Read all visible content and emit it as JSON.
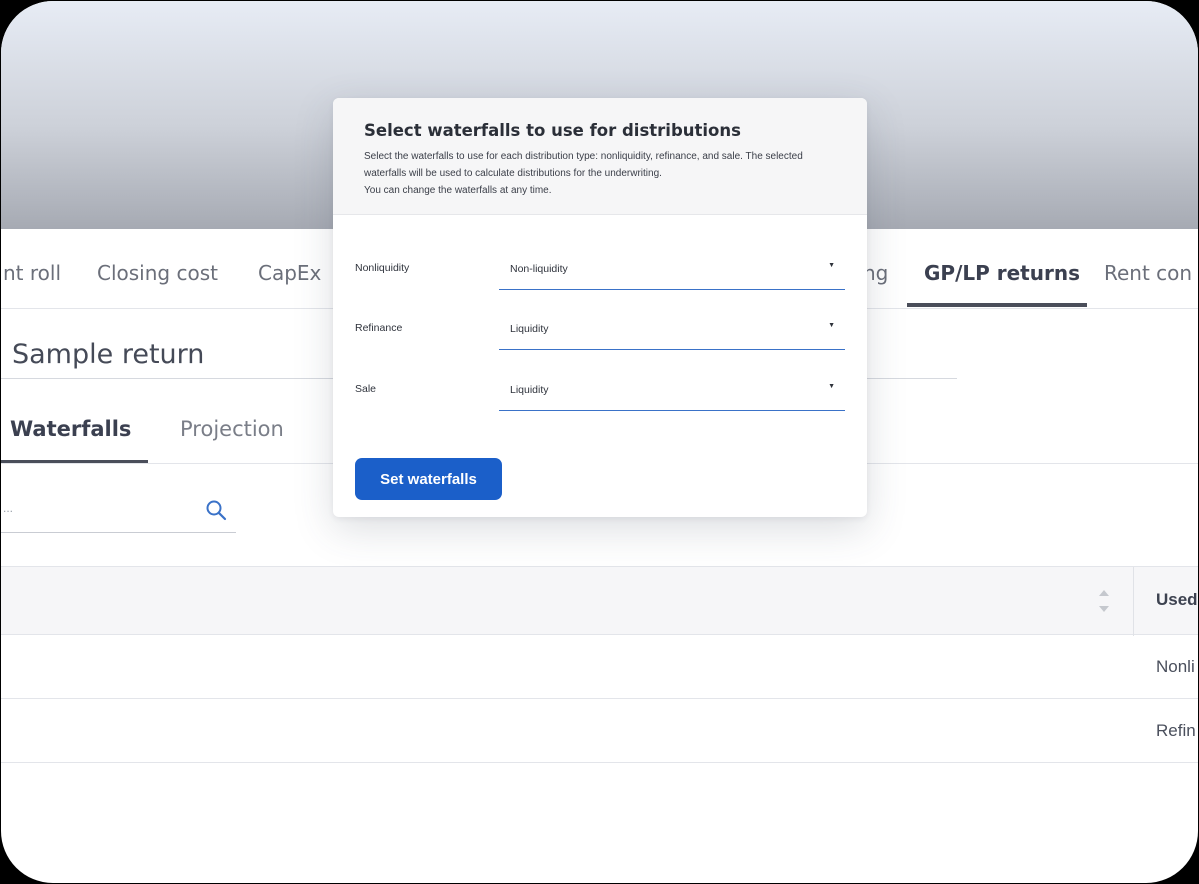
{
  "main_tabs": [
    {
      "label": "nt roll"
    },
    {
      "label": "Closing cost"
    },
    {
      "label": "CapEx"
    },
    {
      "label": "ng"
    },
    {
      "label": "GP/LP returns"
    },
    {
      "label": "Rent con"
    }
  ],
  "page": {
    "title": "Sample return"
  },
  "sub_tabs": [
    {
      "label": "Waterfalls"
    },
    {
      "label": "Projection"
    }
  ],
  "search": {
    "placeholder": "..."
  },
  "table": {
    "used_header": "Used",
    "rows": [
      {
        "used": "Nonli"
      },
      {
        "used": "Refin"
      }
    ]
  },
  "modal": {
    "title": "Select waterfalls to use for distributions",
    "description_line1": "Select the waterfalls to use for each distribution type: nonliquidity, refinance, and sale. The selected waterfalls will be used to calculate distributions for the underwriting.",
    "description_line2": "You can change the waterfalls at any time.",
    "fields": [
      {
        "label": "Nonliquidity",
        "value": "Non-liquidity"
      },
      {
        "label": "Refinance",
        "value": "Liquidity"
      },
      {
        "label": "Sale",
        "value": "Liquidity"
      }
    ],
    "submit_label": "Set waterfalls"
  },
  "colors": {
    "accent": "#1b5fc9",
    "select_underline": "#3a72c8",
    "active_tab": "#3b4050"
  }
}
